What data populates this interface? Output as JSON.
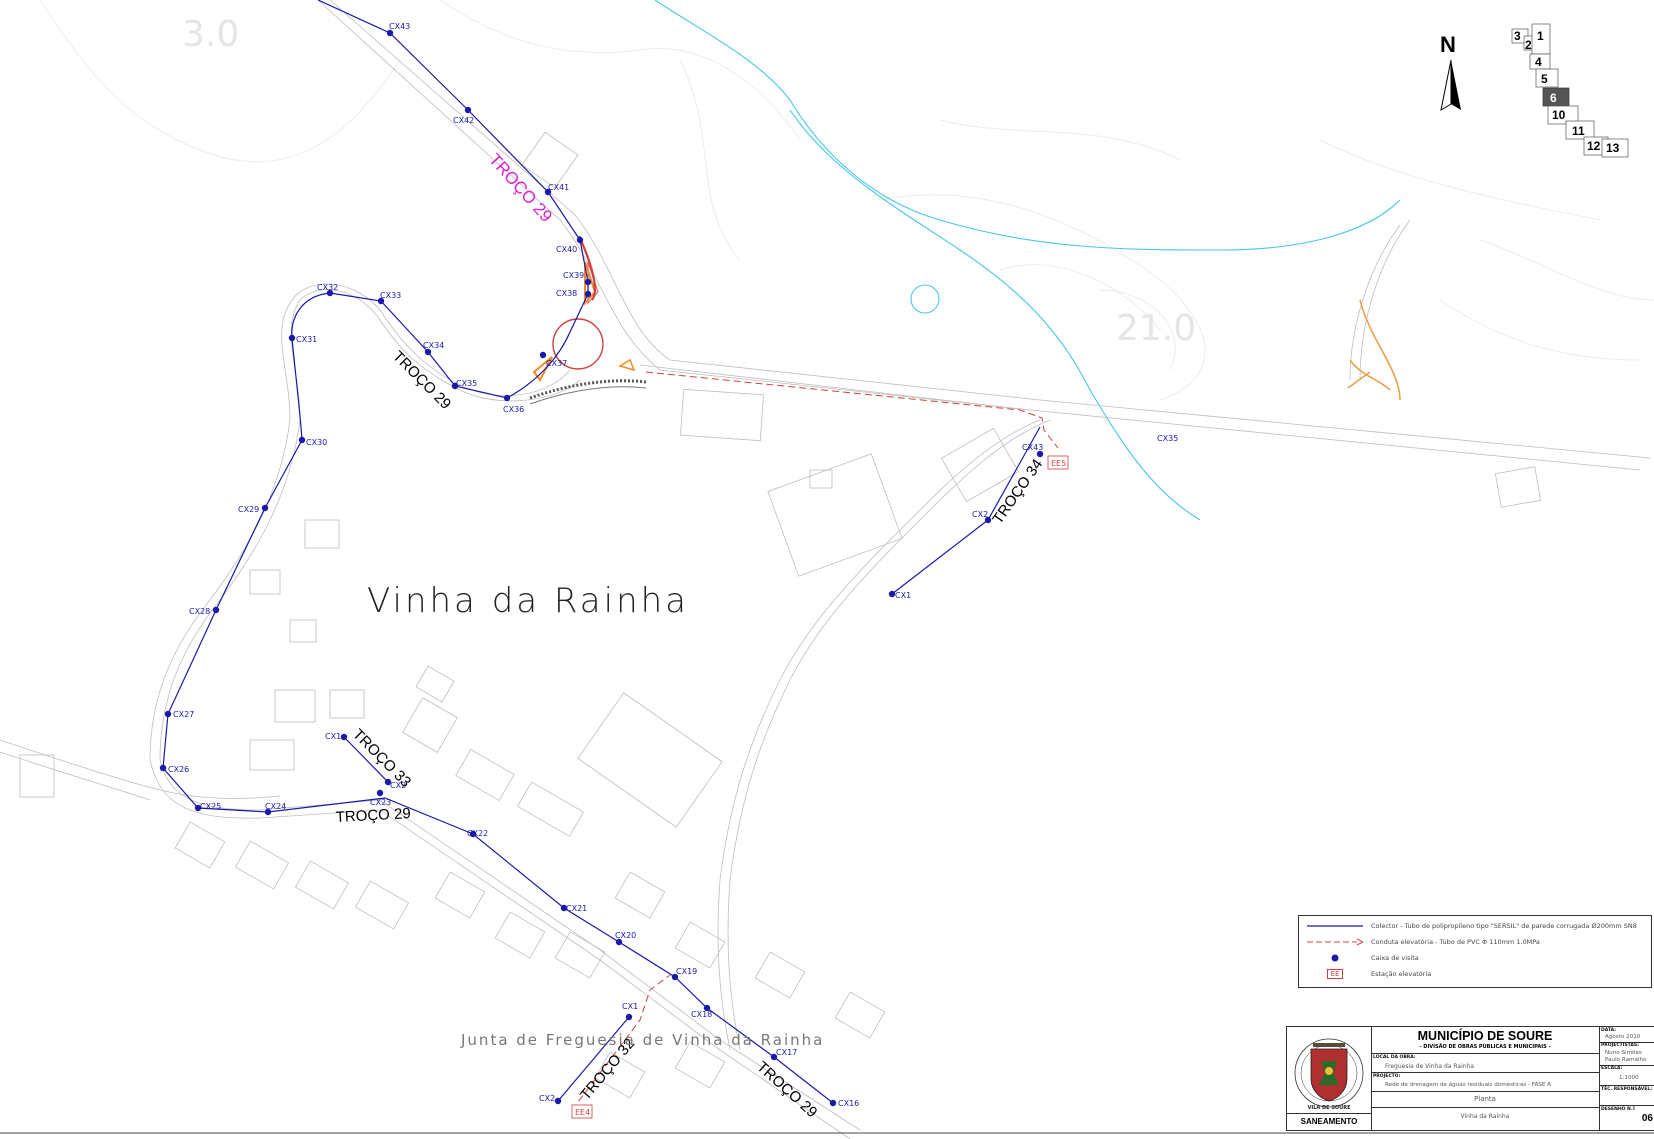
{
  "place_name": "Vinha da Rainha",
  "junta_label": "Junta de Freguesia de Vinha da Rainha",
  "north_label": "N",
  "contour_labels": [
    "3.0",
    "21.0"
  ],
  "troco_labels": [
    "TROÇO 29",
    "TROÇO 29",
    "TROÇO 29",
    "TROÇO 29",
    "TROÇO 33",
    "TROÇO 34",
    "TROÇO 32"
  ],
  "node_labels": {
    "cx43a": "CX43",
    "cx42": "CX42",
    "cx41": "CX41",
    "cx40": "CX40",
    "cx39": "CX39",
    "cx38": "CX38",
    "cx37": "CX37",
    "cx36": "CX36",
    "cx35": "CX35",
    "cx34": "CX34",
    "cx33": "CX33",
    "cx32": "CX32",
    "cx31": "CX31",
    "cx30": "CX30",
    "cx29": "CX29",
    "cx28": "CX28",
    "cx27": "CX27",
    "cx26": "CX26",
    "cx25": "CX25",
    "cx24": "CX24",
    "cx23": "CX23",
    "cx22": "CX22",
    "cx21": "CX21",
    "cx20": "CX20",
    "cx19": "CX19",
    "cx18": "CX18",
    "cx17": "CX17",
    "cx16": "CX16",
    "t33cx1": "CX1",
    "t33cx2": "CX2",
    "t34cx43": "CX43",
    "t34cx2": "CX2",
    "t34cx1": "CX1",
    "t32cx1": "CX1",
    "t32cx2": "CX2",
    "cx35road": "CX35"
  },
  "ee_labels": [
    "EE5",
    "EE4"
  ],
  "sheet_index": [
    "3",
    "2",
    "1",
    "4",
    "5",
    "6",
    "10",
    "11",
    "12",
    "13"
  ],
  "legend": {
    "collector": "Colector - Tubo de polipropileno tipo \"SERSIL\" de parede corrugada Ø200mm SN8",
    "pressure": "Conduta elevatória - Tubo de PVC Φ 110mm 1.0MPa",
    "manhole": "Caixa de visita",
    "ee_symbol": "EE",
    "station": "Estação elevatória"
  },
  "title_block": {
    "municipality": "MUNICÍPIO DE SOURE",
    "division": "- DIVISÃO DE OBRAS PÚBLICAS E MUNICIPAIS -",
    "local_caption": "LOCAL DA OBRA:",
    "local_value": "Freguesia de Vinha da Rainha",
    "project_caption": "PROJECTO:",
    "project_value": "Rede de drenagem de águas residuais domésticas - FASE A",
    "drawing_title": "Planta",
    "drawing_subtitle": "Vinha da Rainha",
    "department": "SANEAMENTO",
    "data_caption": "DATA:",
    "data_value": "Agosto 2010",
    "projectistas_caption": "PROJECTISTAS:",
    "projectista_1": "Nuno Simões",
    "projectista_2": "Paulo Ramalho",
    "escala_caption": "ESCALA:",
    "escala_value": "1:1000",
    "tecnico_caption": "TÉC. RESPONSÁVEL:",
    "desenho_caption": "DESENHO N.º",
    "desenho_value": "06",
    "seal_text": "VILA DE SOURE"
  },
  "colors": {
    "collector": "#1a1aa8",
    "pressure": "#d04040",
    "troco_magenta": "#e020d0",
    "river": "#46c6ea",
    "base_lines": "#bdbdbd",
    "orange": "#e8a24a"
  }
}
